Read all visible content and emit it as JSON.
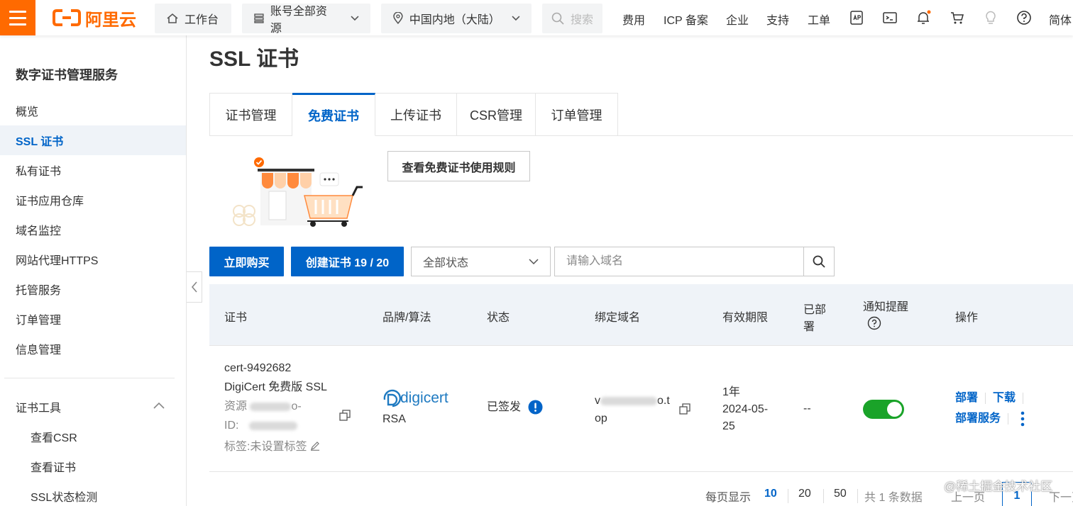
{
  "topbar": {
    "logo_text": "阿里云",
    "workbench": "工作台",
    "resources": "账号全部资源",
    "region": "中国内地（大陆）",
    "search_placeholder": "搜索",
    "links": [
      "费用",
      "ICP 备案",
      "企业",
      "支持",
      "工单"
    ],
    "lang": "简体",
    "accent_color": "#ff6a00"
  },
  "sidebar": {
    "title": "数字证书管理服务",
    "items": [
      {
        "label": "概览"
      },
      {
        "label": "SSL 证书"
      },
      {
        "label": "私有证书"
      },
      {
        "label": "证书应用仓库"
      },
      {
        "label": "域名监控"
      },
      {
        "label": "网站代理HTTPS"
      },
      {
        "label": "托管服务"
      },
      {
        "label": "订单管理"
      },
      {
        "label": "信息管理"
      }
    ],
    "group": {
      "label": "证书工具",
      "items": [
        {
          "label": "查看CSR"
        },
        {
          "label": "查看证书"
        },
        {
          "label": "SSL状态检测"
        }
      ]
    }
  },
  "main": {
    "title": "SSL 证书",
    "tabs": [
      {
        "label": "证书管理"
      },
      {
        "label": "免费证书"
      },
      {
        "label": "上传证书"
      },
      {
        "label": "CSR管理"
      },
      {
        "label": "订单管理"
      }
    ],
    "rules_button": "查看免费证书使用规则",
    "buy_button": "立即购买",
    "create_button": "创建证书 19 / 20",
    "status_select": "全部状态",
    "domain_placeholder": "请输入域名"
  },
  "table": {
    "headers": {
      "cert": "证书",
      "brand": "品牌/算法",
      "status": "状态",
      "domain": "绑定域名",
      "validity": "有效期限",
      "deployed_1": "已部",
      "deployed_2": "署",
      "notify": "通知提醒",
      "actions": "操作"
    },
    "row": {
      "cert_id": "cert-9492682",
      "cert_name": "DigiCert 免费版 SSL",
      "resource_label": "资源",
      "resource_suffix": "o-",
      "id_label": "ID:",
      "tag_text": "标签:未设置标签",
      "brand_logo": "digicert",
      "algorithm": "RSA",
      "status": "已签发",
      "domain_prefix": "v",
      "domain_mid": "o.t",
      "domain_suffix": "op",
      "validity_term": "1年",
      "validity_date_1": "2024-05-",
      "validity_date_2": "25",
      "deployed": "--",
      "notify_on": true,
      "action_deploy": "部署",
      "action_download": "下载",
      "action_deploy_service": "部署服务"
    }
  },
  "pagination": {
    "per_page_label": "每页显示",
    "sizes": [
      "10",
      "20",
      "50"
    ],
    "total": "共 1 条数据",
    "prev": "上一页",
    "current": "1",
    "next": "下一页"
  },
  "watermark": "@稀土掘金技术社区"
}
